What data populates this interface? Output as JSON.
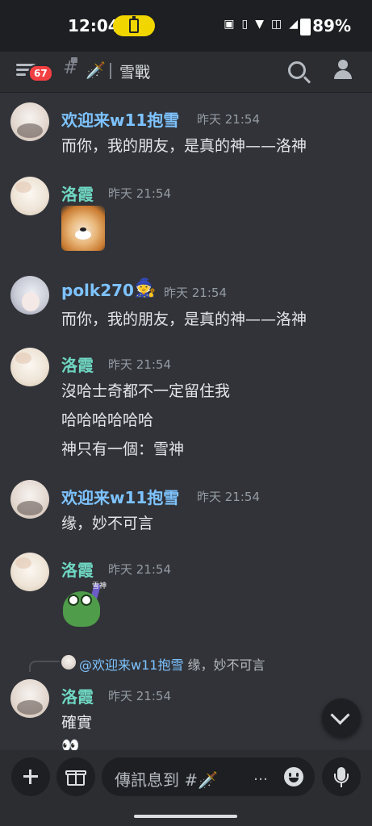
{
  "status_bar": {
    "time": "12:04",
    "battery_percent": "89%",
    "icons": [
      "nfc-icon",
      "vibrate-icon",
      "wifi-icon",
      "volte-icon",
      "signal-icon",
      "battery-icon"
    ]
  },
  "header": {
    "notification_count": "67",
    "channel_emoji": "🗡️",
    "channel_name": "雪戰"
  },
  "messages": [
    {
      "author": "欢迎来w11抱雪",
      "timestamp": "昨天 21:54",
      "lines": [
        "而你，我的朋友，是真的神——洛神"
      ]
    },
    {
      "author": "洛霞",
      "timestamp": "昨天 21:54",
      "attachment": "shiba-dog-emoji"
    },
    {
      "author": "polk270",
      "badge_emoji": "🧙",
      "timestamp": "昨天 21:54",
      "lines": [
        "而你，我的朋友，是真的神——洛神"
      ]
    },
    {
      "author": "洛霞",
      "timestamp": "昨天 21:54",
      "lines": [
        "沒哈士奇都不一定留住我",
        "哈哈哈哈哈哈",
        "神只有一個：雪神"
      ]
    },
    {
      "author": "欢迎来w11抱雪",
      "timestamp": "昨天 21:54",
      "lines": [
        "缘，妙不可言"
      ]
    },
    {
      "author": "洛霞",
      "timestamp": "昨天 21:54",
      "attachment": "frog-sword-sticker",
      "sticker_label": "雪神"
    },
    {
      "reply_to": {
        "user": "@欢迎来w11抱雪",
        "quote": "缘，妙不可言"
      },
      "author": "洛霞",
      "timestamp": "昨天 21:54",
      "lines": [
        "確實"
      ],
      "trailing_emoji": "👀"
    }
  ],
  "composer": {
    "placeholder": "傳訊息到 #🗡️",
    "overflow": "…"
  },
  "colors": {
    "background": "#313338",
    "header_bg": "#2b2d31",
    "username_blue": "#7ec3ff",
    "username_teal": "#6fd6c2",
    "badge_red": "#f23f42",
    "battery_pill": "#f2d600"
  }
}
